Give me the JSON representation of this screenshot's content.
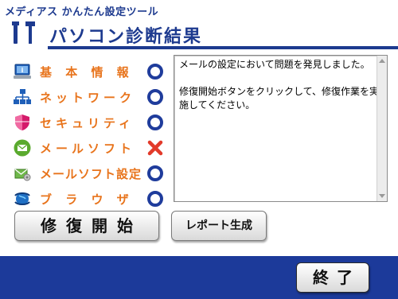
{
  "app": {
    "title": "メディアス かんたん設定ツール"
  },
  "header": {
    "title": "パソコン診断結果",
    "icon": "tools-icon"
  },
  "diagnostics": [
    {
      "label": "基 本 情 報",
      "icon": "info-icon",
      "status": "ok"
    },
    {
      "label": "ネットワーク",
      "icon": "network-icon",
      "status": "ok"
    },
    {
      "label": "セキュリティ",
      "icon": "security-shield-icon",
      "status": "ok"
    },
    {
      "label": "メールソフト",
      "icon": "mail-icon",
      "status": "error"
    },
    {
      "label": "メールソフト設定",
      "icon": "mail-settings-icon",
      "status": "ok"
    },
    {
      "label": "ブ ラ ウ ザ",
      "icon": "browser-icon",
      "status": "ok"
    }
  ],
  "message": {
    "line1": "メールの設定において問題を発見しました。",
    "line2": "修復開始ボタンをクリックして、修復作業を実施してください。"
  },
  "buttons": {
    "repair": "修復開始",
    "report": "レポート生成",
    "exit": "終了"
  },
  "colors": {
    "brand": "#1d3a8f",
    "label": "#e8741c",
    "ok_ring": "#1f3c9c",
    "error_x": "#e23a2a"
  }
}
